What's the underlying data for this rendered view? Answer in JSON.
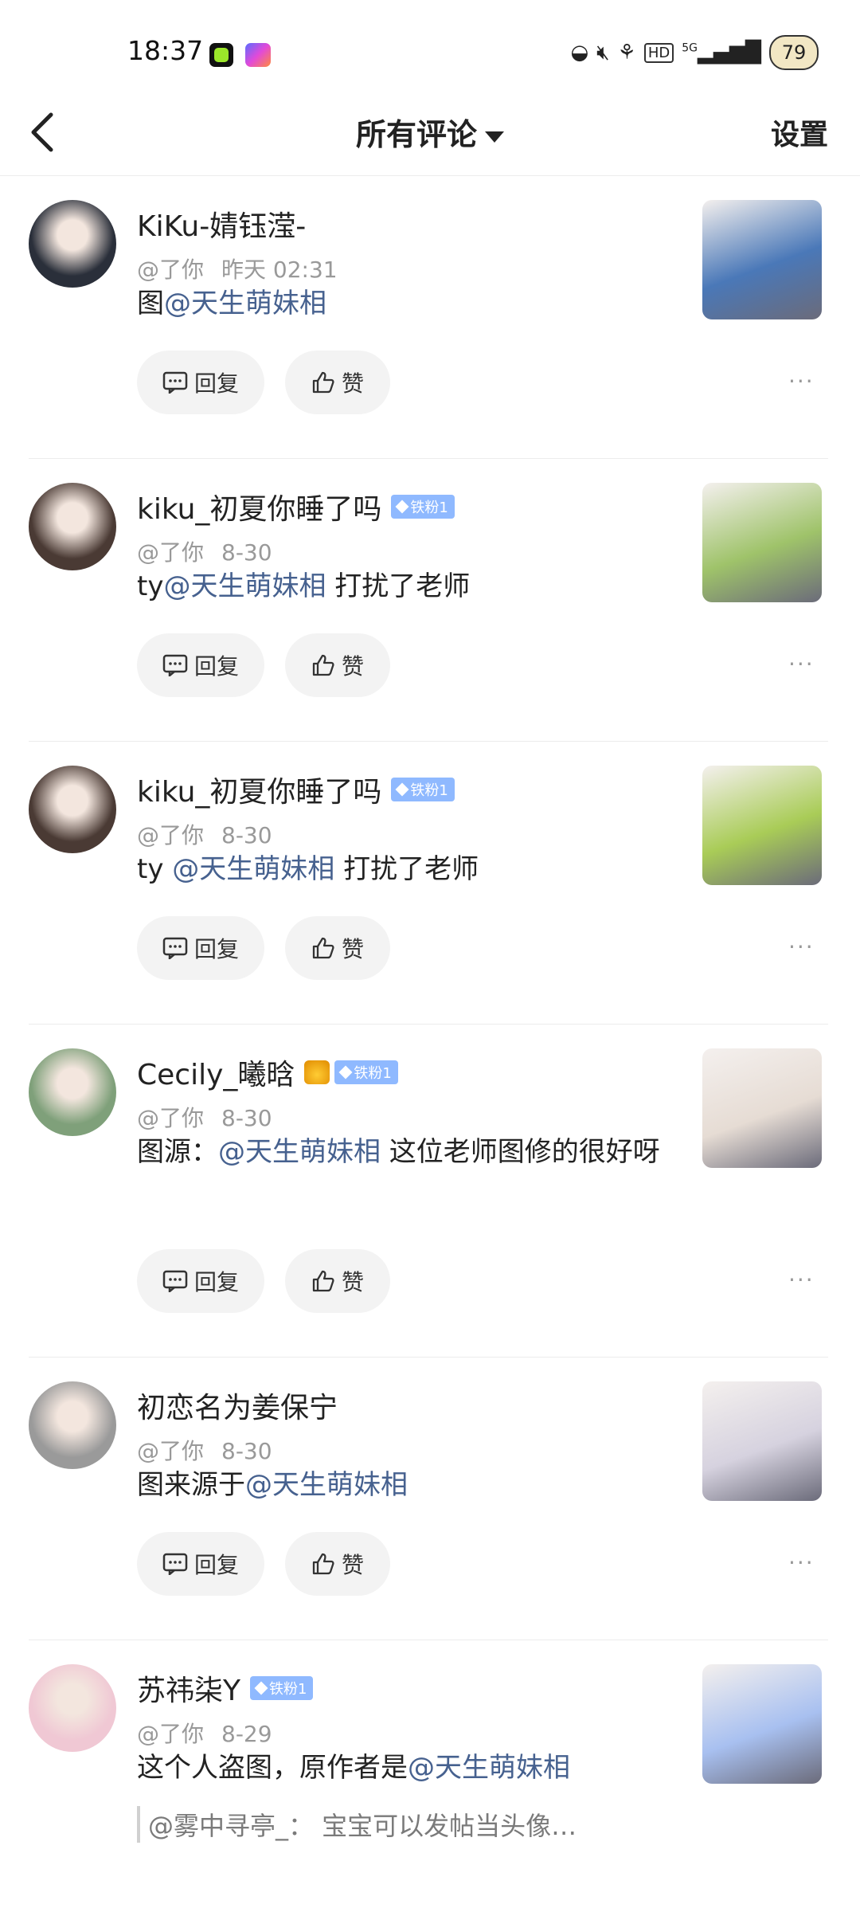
{
  "status_bar": {
    "time": "18:37",
    "network": "5G",
    "battery": "79",
    "icons": [
      "nfc-icon",
      "mute-icon",
      "eco-icon",
      "hd-icon",
      "signal-icon"
    ]
  },
  "header": {
    "back_icon": "back-arrow-icon",
    "title": "所有评论",
    "settings": "设置"
  },
  "actions": {
    "reply": "回复",
    "like": "赞",
    "more": "···"
  },
  "comments": [
    {
      "name": "KiKu-婧钰滢-",
      "badge": "",
      "crown": false,
      "mention": "@了你",
      "time": "昨天 02:31",
      "text_before": "图",
      "mention_user": "@天生萌妹相",
      "text_after": "",
      "avatar_color": "#2a2f3a",
      "thumb_color": "#4a78b8"
    },
    {
      "name": "kiku_初夏你睡了吗",
      "badge": "铁粉1",
      "crown": false,
      "mention": "@了你",
      "time": "8-30",
      "text_before": "ty",
      "mention_user": "@天生萌妹相",
      "text_after": " 打扰了老师",
      "avatar_color": "#4a3a34",
      "thumb_color": "#9fc36a"
    },
    {
      "name": "kiku_初夏你睡了吗",
      "badge": "铁粉1",
      "crown": false,
      "mention": "@了你",
      "time": "8-30",
      "text_before": "ty ",
      "mention_user": "@天生萌妹相",
      "text_after": " 打扰了老师",
      "avatar_color": "#4a3a34",
      "thumb_color": "#a9cc57"
    },
    {
      "name": "Cecily_曦晗",
      "badge": "铁粉1",
      "crown": true,
      "mention": "@了你",
      "time": "8-30",
      "text_before": "图源：",
      "mention_user": "@天生萌妹相",
      "text_after": "  这位老师图修的很好呀",
      "avatar_color": "#7fa07a",
      "thumb_color": "#e6dcd4"
    },
    {
      "name": "初恋名为姜保宁",
      "badge": "",
      "crown": false,
      "mention": "@了你",
      "time": "8-30",
      "text_before": "图来源于",
      "mention_user": "@天生萌妹相",
      "text_after": "",
      "avatar_color": "#9a9a9a",
      "thumb_color": "#d6d2df"
    },
    {
      "name": "苏祎柒Y",
      "badge": "铁粉1",
      "crown": false,
      "mention": "@了你",
      "time": "8-29",
      "text_before": "这个人盗图，原作者是",
      "mention_user": "@天生萌妹相",
      "text_after": "",
      "quote": "@雾中寻亭_：  宝宝可以发帖当头像…",
      "avatar_color": "#f0c8d4",
      "thumb_color": "#a8c0f0"
    }
  ]
}
